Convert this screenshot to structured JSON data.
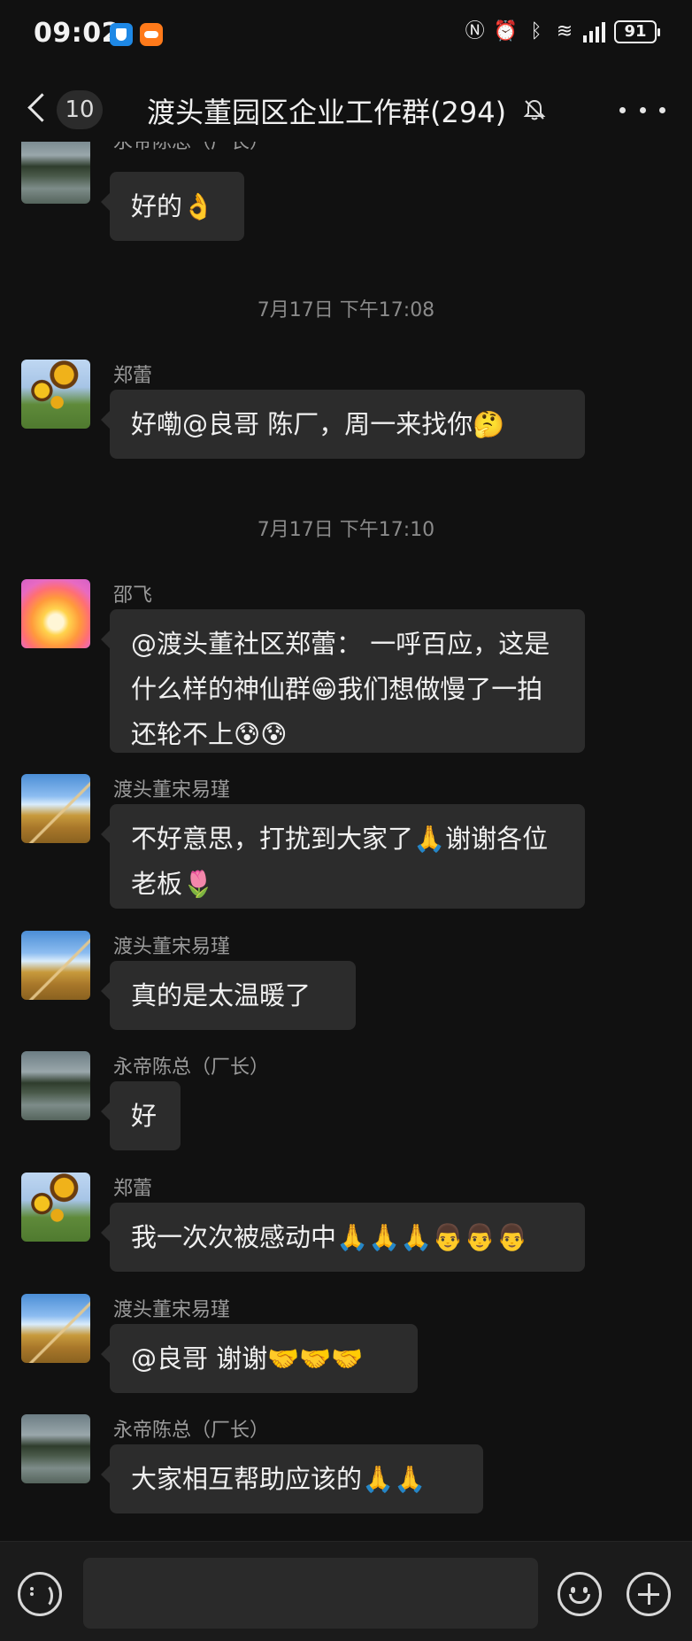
{
  "status_bar": {
    "time": "09:02",
    "battery": "91",
    "icons": [
      "shield-app-icon",
      "orange-app-icon",
      "nfc-icon",
      "alarm-icon",
      "bluetooth-icon",
      "wifi-icon",
      "signal-icon",
      "battery-icon"
    ]
  },
  "header": {
    "unread_count": "10",
    "title": "渡头董园区企业工作群(294)",
    "icons": [
      "back-arrow-icon",
      "mute-bell-icon",
      "more-dots-icon"
    ]
  },
  "messages": [
    {
      "kind": "message",
      "sender": "永帝陈总（厂长）",
      "avatar": "lake-photo",
      "text": "好的👌"
    },
    {
      "kind": "timestamp",
      "text": "7月17日 下午17:08"
    },
    {
      "kind": "message",
      "sender": "郑蕾",
      "avatar": "sunflower-photo",
      "text": "好嘞@良哥  陈厂，周一来找你🤔"
    },
    {
      "kind": "timestamp",
      "text": "7月17日 下午17:10"
    },
    {
      "kind": "message",
      "sender": "邵飞",
      "avatar": "sunset-photo",
      "text": "@渡头董社区郑蕾： 一呼百应，这是什么样的神仙群😁我们想做慢了一拍还轮不上😰😰"
    },
    {
      "kind": "message",
      "sender": "渡头董宋易瑾",
      "avatar": "grass-photo",
      "text": "不好意思，打扰到大家了🙏谢谢各位老板🌷"
    },
    {
      "kind": "message",
      "sender": "渡头董宋易瑾",
      "avatar": "grass-photo",
      "text": "真的是太温暖了"
    },
    {
      "kind": "message",
      "sender": "永帝陈总（厂长）",
      "avatar": "lake-photo",
      "text": "好"
    },
    {
      "kind": "message",
      "sender": "郑蕾",
      "avatar": "sunflower-photo",
      "text": "我一次次被感动中🙏🙏🙏👨👨👨"
    },
    {
      "kind": "message",
      "sender": "渡头董宋易瑾",
      "avatar": "grass-photo",
      "text": "@良哥  谢谢🤝🤝🤝"
    },
    {
      "kind": "message",
      "sender": "永帝陈总（厂长）",
      "avatar": "lake-photo",
      "text": "大家相互帮助应该的🙏🙏"
    }
  ],
  "input_bar": {
    "icons": [
      "voice-icon",
      "emoji-icon",
      "plus-icon"
    ]
  },
  "colors": {
    "background": "#111111",
    "bubble": "#2c2c2c",
    "text": "#f0f0f0",
    "secondary_text": "#9a9a9a"
  }
}
